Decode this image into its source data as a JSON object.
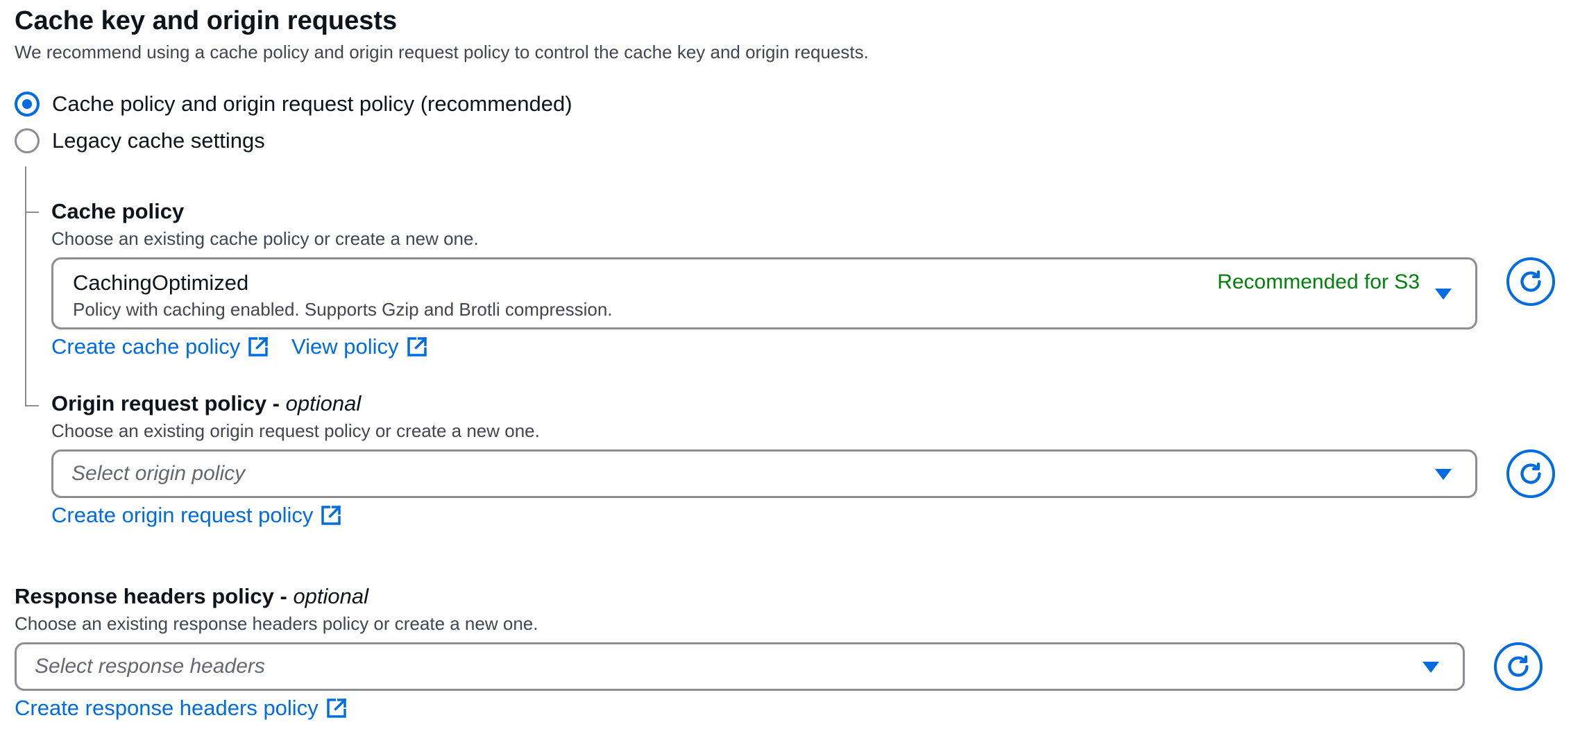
{
  "section": {
    "title": "Cache key and origin requests",
    "description": "We recommend using a cache policy and origin request policy to control the cache key and origin requests."
  },
  "radio_options": [
    {
      "label": "Cache policy and origin request policy (recommended)",
      "selected": true
    },
    {
      "label": "Legacy cache settings",
      "selected": false
    }
  ],
  "cache_policy": {
    "label": "Cache policy",
    "description": "Choose an existing cache policy or create a new one.",
    "selected_title": "CachingOptimized",
    "selected_description": "Policy with caching enabled. Supports Gzip and Brotli compression.",
    "badge": "Recommended for S3",
    "create_link": "Create cache policy",
    "view_link": "View policy"
  },
  "origin_request_policy": {
    "label": "Origin request policy -",
    "optional": "optional",
    "description": "Choose an existing origin request policy or create a new one.",
    "placeholder": "Select origin policy",
    "create_link": "Create origin request policy"
  },
  "response_headers_policy": {
    "label": "Response headers policy -",
    "optional": "optional",
    "description": "Choose an existing response headers policy or create a new one.",
    "placeholder": "Select response headers",
    "create_link": "Create response headers policy"
  },
  "icons": {
    "dropdown": "caret-down-icon",
    "refresh": "refresh-icon",
    "external": "external-link-icon"
  },
  "colors": {
    "accent": "#006ce0",
    "success": "#037f0c",
    "border": "#8c8c94"
  }
}
